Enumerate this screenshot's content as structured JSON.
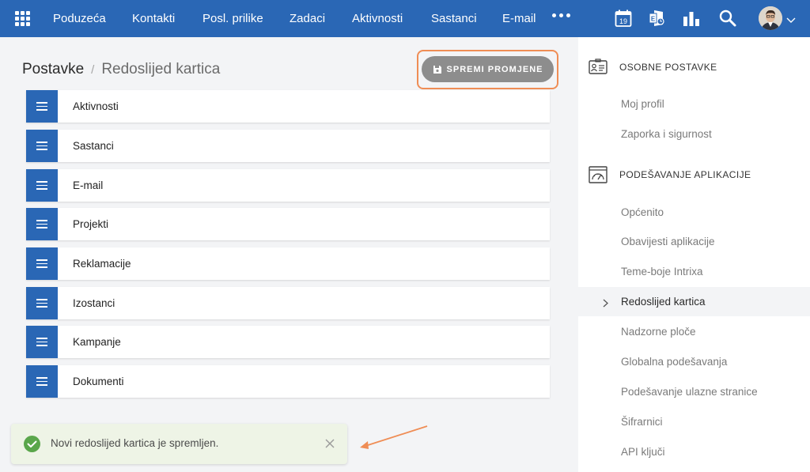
{
  "topbar": {
    "nav": [
      "Poduzeća",
      "Kontakti",
      "Posl. prilike",
      "Zadaci",
      "Aktivnosti",
      "Sastanci",
      "E-mail"
    ],
    "calendar_day": "19",
    "icons": [
      "apps-grid-icon",
      "more-icon",
      "calendar-icon",
      "exchange-icon",
      "reports-icon",
      "search-icon",
      "chevron-down-icon"
    ]
  },
  "header": {
    "breadcrumb_root": "Postavke",
    "breadcrumb_sep": "/",
    "breadcrumb_current": "Redoslijed kartica",
    "save_label": "SPREMI PROMJENE"
  },
  "tabs_order": [
    {
      "label": "Aktivnosti"
    },
    {
      "label": "Sastanci"
    },
    {
      "label": "E-mail"
    },
    {
      "label": "Projekti"
    },
    {
      "label": "Reklamacije"
    },
    {
      "label": "Izostanci"
    },
    {
      "label": "Kampanje"
    },
    {
      "label": "Dokumenti"
    }
  ],
  "toast": {
    "message": "Novi redoslijed kartica je spremljen."
  },
  "sidebar": {
    "personal": {
      "title": "OSOBNE POSTAVKE",
      "items": [
        "Moj profil",
        "Zaporka i sigurnost"
      ]
    },
    "app": {
      "title": "PODEŠAVANJE APLIKACIJE",
      "items": [
        "Općenito",
        "Obavijesti aplikacije",
        "Teme-boje Intrixa",
        "Redoslijed kartica",
        "Nadzorne ploče",
        "Globalna podešavanja",
        "Podešavanje ulazne stranice",
        "Šifrarnici",
        "API ključi"
      ],
      "active_index": 3
    }
  },
  "colors": {
    "brand_blue": "#2a67b5",
    "highlight_orange": "#ef8d55",
    "success_green": "#5aa64b",
    "save_button_grey": "#8d8d8d"
  }
}
